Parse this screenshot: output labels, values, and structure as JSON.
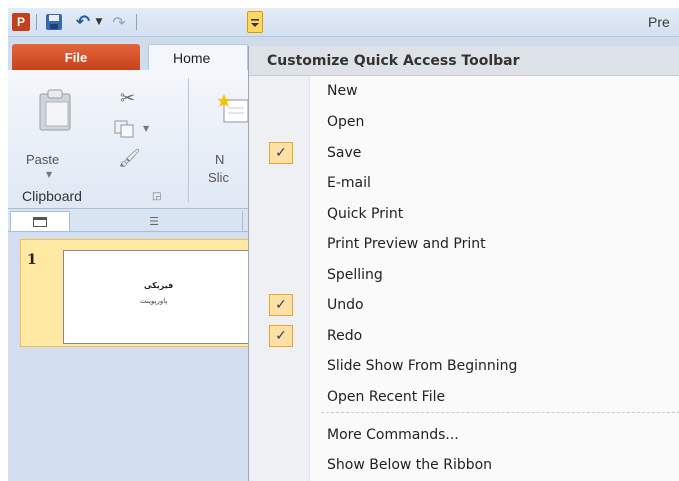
{
  "window": {
    "title": "Pre"
  },
  "quick_access": {
    "logo": "P",
    "buttons": [
      {
        "name": "save",
        "icon": "floppy-disk-icon"
      },
      {
        "name": "undo",
        "icon": "undo-icon"
      },
      {
        "name": "redo",
        "icon": "redo-icon"
      },
      {
        "name": "customize",
        "icon": "chevron-down-icon"
      }
    ]
  },
  "ribbon": {
    "tabs": {
      "file": "File",
      "home": "Home"
    },
    "paste_label": "Paste",
    "new_slide_label_1": "N",
    "new_slide_label_2": "Slic",
    "clipboard_group": "Clipboard"
  },
  "slides": {
    "number": "1",
    "title": "فیزیکی",
    "subtitle": "پاورپوینت"
  },
  "qat_menu": {
    "header": "Customize Quick Access Toolbar",
    "items": [
      {
        "label": "New",
        "checked": false
      },
      {
        "label": "Open",
        "checked": false
      },
      {
        "label": "Save",
        "checked": true
      },
      {
        "label": "E-mail",
        "checked": false
      },
      {
        "label": "Quick Print",
        "checked": false
      },
      {
        "label": "Print Preview and Print",
        "checked": false
      },
      {
        "label": "Spelling",
        "checked": false
      },
      {
        "label": "Undo",
        "checked": true
      },
      {
        "label": "Redo",
        "checked": true
      },
      {
        "label": "Slide Show From Beginning",
        "checked": false
      },
      {
        "label": "Open Recent File",
        "checked": false
      },
      {
        "label": "More Commands...",
        "checked": false
      },
      {
        "label": "Show Below the Ribbon",
        "checked": false
      }
    ],
    "check_glyph": "✓"
  },
  "colors": {
    "file_tab": "#d24a1f",
    "checked_bg": "#fde0a3",
    "slide_selection": "#ffe9a3"
  }
}
